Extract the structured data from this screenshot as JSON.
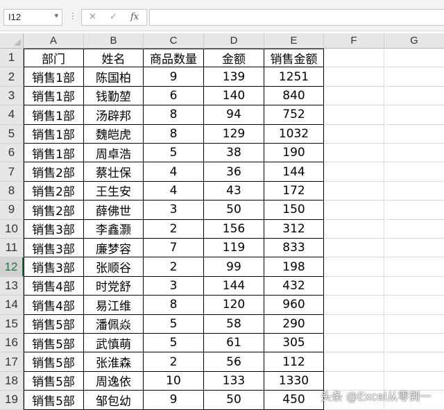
{
  "formula_bar": {
    "name_box": "I12",
    "cancel_icon": "✕",
    "enter_icon": "✓",
    "fx_label": "fx",
    "formula": ""
  },
  "columns": [
    "A",
    "B",
    "C",
    "D",
    "E",
    "F",
    "G"
  ],
  "table": {
    "headers": [
      "部门",
      "姓名",
      "商品数量",
      "金额",
      "销售金额"
    ],
    "rows": [
      [
        "销售1部",
        "陈国柏",
        "9",
        "139",
        "1251"
      ],
      [
        "销售1部",
        "钱勤堃",
        "6",
        "140",
        "840"
      ],
      [
        "销售1部",
        "汤辟邦",
        "8",
        "94",
        "752"
      ],
      [
        "销售1部",
        "魏皑虎",
        "8",
        "129",
        "1032"
      ],
      [
        "销售1部",
        "周卓浩",
        "5",
        "38",
        "190"
      ],
      [
        "销售2部",
        "蔡壮保",
        "4",
        "36",
        "144"
      ],
      [
        "销售2部",
        "王生安",
        "4",
        "43",
        "172"
      ],
      [
        "销售2部",
        "薛佛世",
        "3",
        "50",
        "150"
      ],
      [
        "销售3部",
        "李鑫灏",
        "2",
        "156",
        "312"
      ],
      [
        "销售3部",
        "廉梦容",
        "7",
        "119",
        "833"
      ],
      [
        "销售3部",
        "张顺谷",
        "2",
        "99",
        "198"
      ],
      [
        "销售4部",
        "时党舒",
        "3",
        "144",
        "432"
      ],
      [
        "销售4部",
        "易江维",
        "8",
        "120",
        "960"
      ],
      [
        "销售5部",
        "潘佩焱",
        "5",
        "58",
        "290"
      ],
      [
        "销售5部",
        "武慎萌",
        "5",
        "61",
        "305"
      ],
      [
        "销售5部",
        "张淮森",
        "2",
        "56",
        "112"
      ],
      [
        "销售5部",
        "周逸依",
        "10",
        "133",
        "1330"
      ],
      [
        "销售5部",
        "邹包幼",
        "9",
        "50",
        "450"
      ]
    ]
  },
  "row_numbers": [
    "1",
    "2",
    "3",
    "4",
    "5",
    "6",
    "7",
    "8",
    "9",
    "10",
    "11",
    "12",
    "13",
    "14",
    "15",
    "16",
    "17",
    "18",
    "19"
  ],
  "selected_row": "12",
  "watermark": "头条 @Excel从零到一"
}
